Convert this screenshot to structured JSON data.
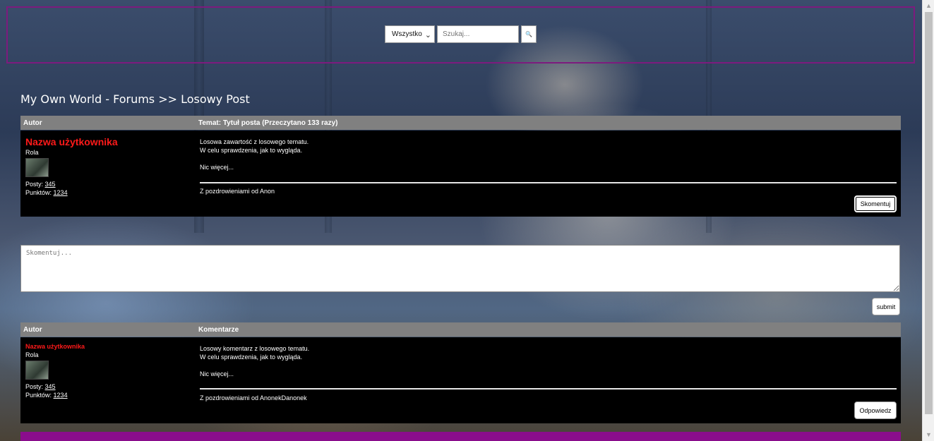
{
  "header": {
    "search_category": "Wszystko",
    "search_placeholder": "Szukaj...",
    "search_button_glyph": "🔍"
  },
  "breadcrumb": "My Own World - Forums >> Losowy Post",
  "post_table": {
    "col_author": "Autor",
    "col_topic": "Temat: Tytuł posta (Przeczytano 133 razy)"
  },
  "post": {
    "username": "Nazwa użytkownika",
    "role": "Rola",
    "posts_label": "Posty:",
    "posts_value": "345",
    "points_label": "Punktów:",
    "points_value": "1234",
    "lines": [
      "Losowa zawartość z losowego tematu.",
      "W celu sprawdzenia, jak to wygląda.",
      "",
      "Nic więcej..."
    ],
    "signature": "Z pozdrowieniami od Anon",
    "comment_button": "Skomentuj"
  },
  "comment_form": {
    "placeholder": "Skomentuj...",
    "submit_label": "submit"
  },
  "comments_table": {
    "col_author": "Autor",
    "col_comments": "Komentarze"
  },
  "comment": {
    "username": "Nazwa użytkownika",
    "role": "Rola",
    "posts_label": "Posty:",
    "posts_value": "345",
    "points_label": "Punktów:",
    "points_value": "1234",
    "lines": [
      "Losowy komentarz z losowego tematu.",
      "W celu sprawdzenia, jak to wygląda.",
      "",
      "Nic więcej..."
    ],
    "signature": "Z pozdrowieniami od AnonekDanonek",
    "reply_button": "Odpowiedz"
  },
  "colors": {
    "accent": "#7d1b7e",
    "username": "#ff1a1a",
    "header_row": "#808080"
  }
}
